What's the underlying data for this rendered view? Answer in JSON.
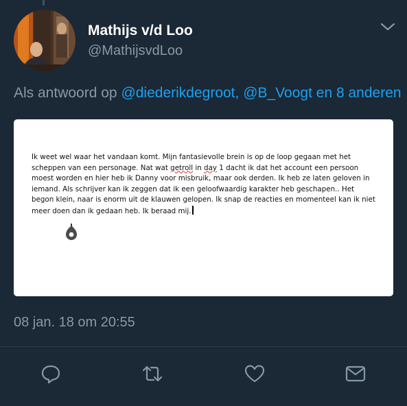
{
  "tweet": {
    "author": {
      "display_name": "Mathijs v/d Loo",
      "handle": "@MathijsvdLoo"
    },
    "reply_context": {
      "prefix": "Als antwoord op ",
      "mention_1": "@diederikdegroot,",
      "mention_2": "@B_Voogt",
      "joiner": " en ",
      "others": "8 anderen"
    },
    "attached_image": {
      "text_before": "Ik weet wel waar het vandaan komt. Mijn fantasievolle brein is op de loop gegaan met het scheppen van een personage. Nat wat ",
      "underlined_1": "getroll",
      "text_mid_1": " in ",
      "underlined_2": "day",
      "text_after": " 1 dacht ik dat het account een persoon moest worden en hier heb ik Danny voor misbruik, maar ook derden. Ik heb ze laten geloven in iemand. Als schrijver kan ik zeggen dat ik een geloofwaardig karakter heb geschapen.. Het begon klein, naar is enorm uit de klauwen gelopen. Ik snap de reacties en momenteel kan ik niet meer doen dan ik gedaan heb. Ik beraad mij."
    },
    "timestamp": "08 jan. 18 om 20:55"
  },
  "actions": {
    "reply_icon": "speech-bubble",
    "retweet_icon": "retweet-arrows",
    "like_icon": "heart-outline",
    "dm_icon": "envelope"
  },
  "colors": {
    "background": "#1b2836",
    "accent": "#1da1f2",
    "secondary_text": "#8899a6",
    "primary_text": "#ffffff"
  }
}
